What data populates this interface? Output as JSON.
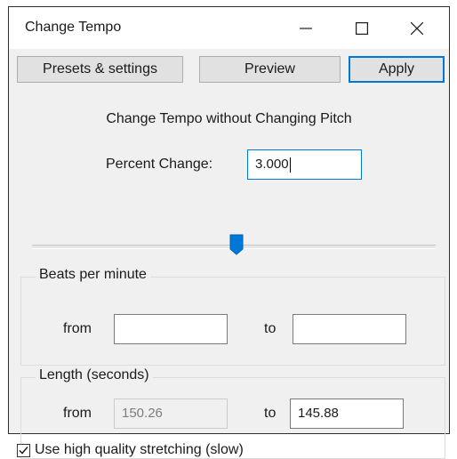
{
  "window": {
    "title": "Change Tempo"
  },
  "titlebar": {
    "minimize_icon": "minimize-icon",
    "maximize_icon": "maximize-icon",
    "close_icon": "close-icon"
  },
  "toolbar": {
    "presets_label": "Presets & settings",
    "preview_label": "Preview",
    "apply_label": "Apply"
  },
  "main": {
    "heading": "Change Tempo without Changing Pitch",
    "percent_label": "Percent Change:",
    "percent_value": "3.000",
    "slider_level": 0.506
  },
  "bpm": {
    "title": "Beats per minute",
    "from_label": "from",
    "from_value": "",
    "to_label": "to",
    "to_value": ""
  },
  "length": {
    "title": "Length (seconds)",
    "from_label": "from",
    "from_value": "150.26",
    "to_label": "to",
    "to_value": "145.88"
  },
  "options": {
    "high_quality_label": "Use high quality stretching (slow)",
    "high_quality_checked": true
  },
  "colors": {
    "accent": "#0078d7",
    "panel": "#f0f0f0",
    "button": "#e1e1e1"
  }
}
